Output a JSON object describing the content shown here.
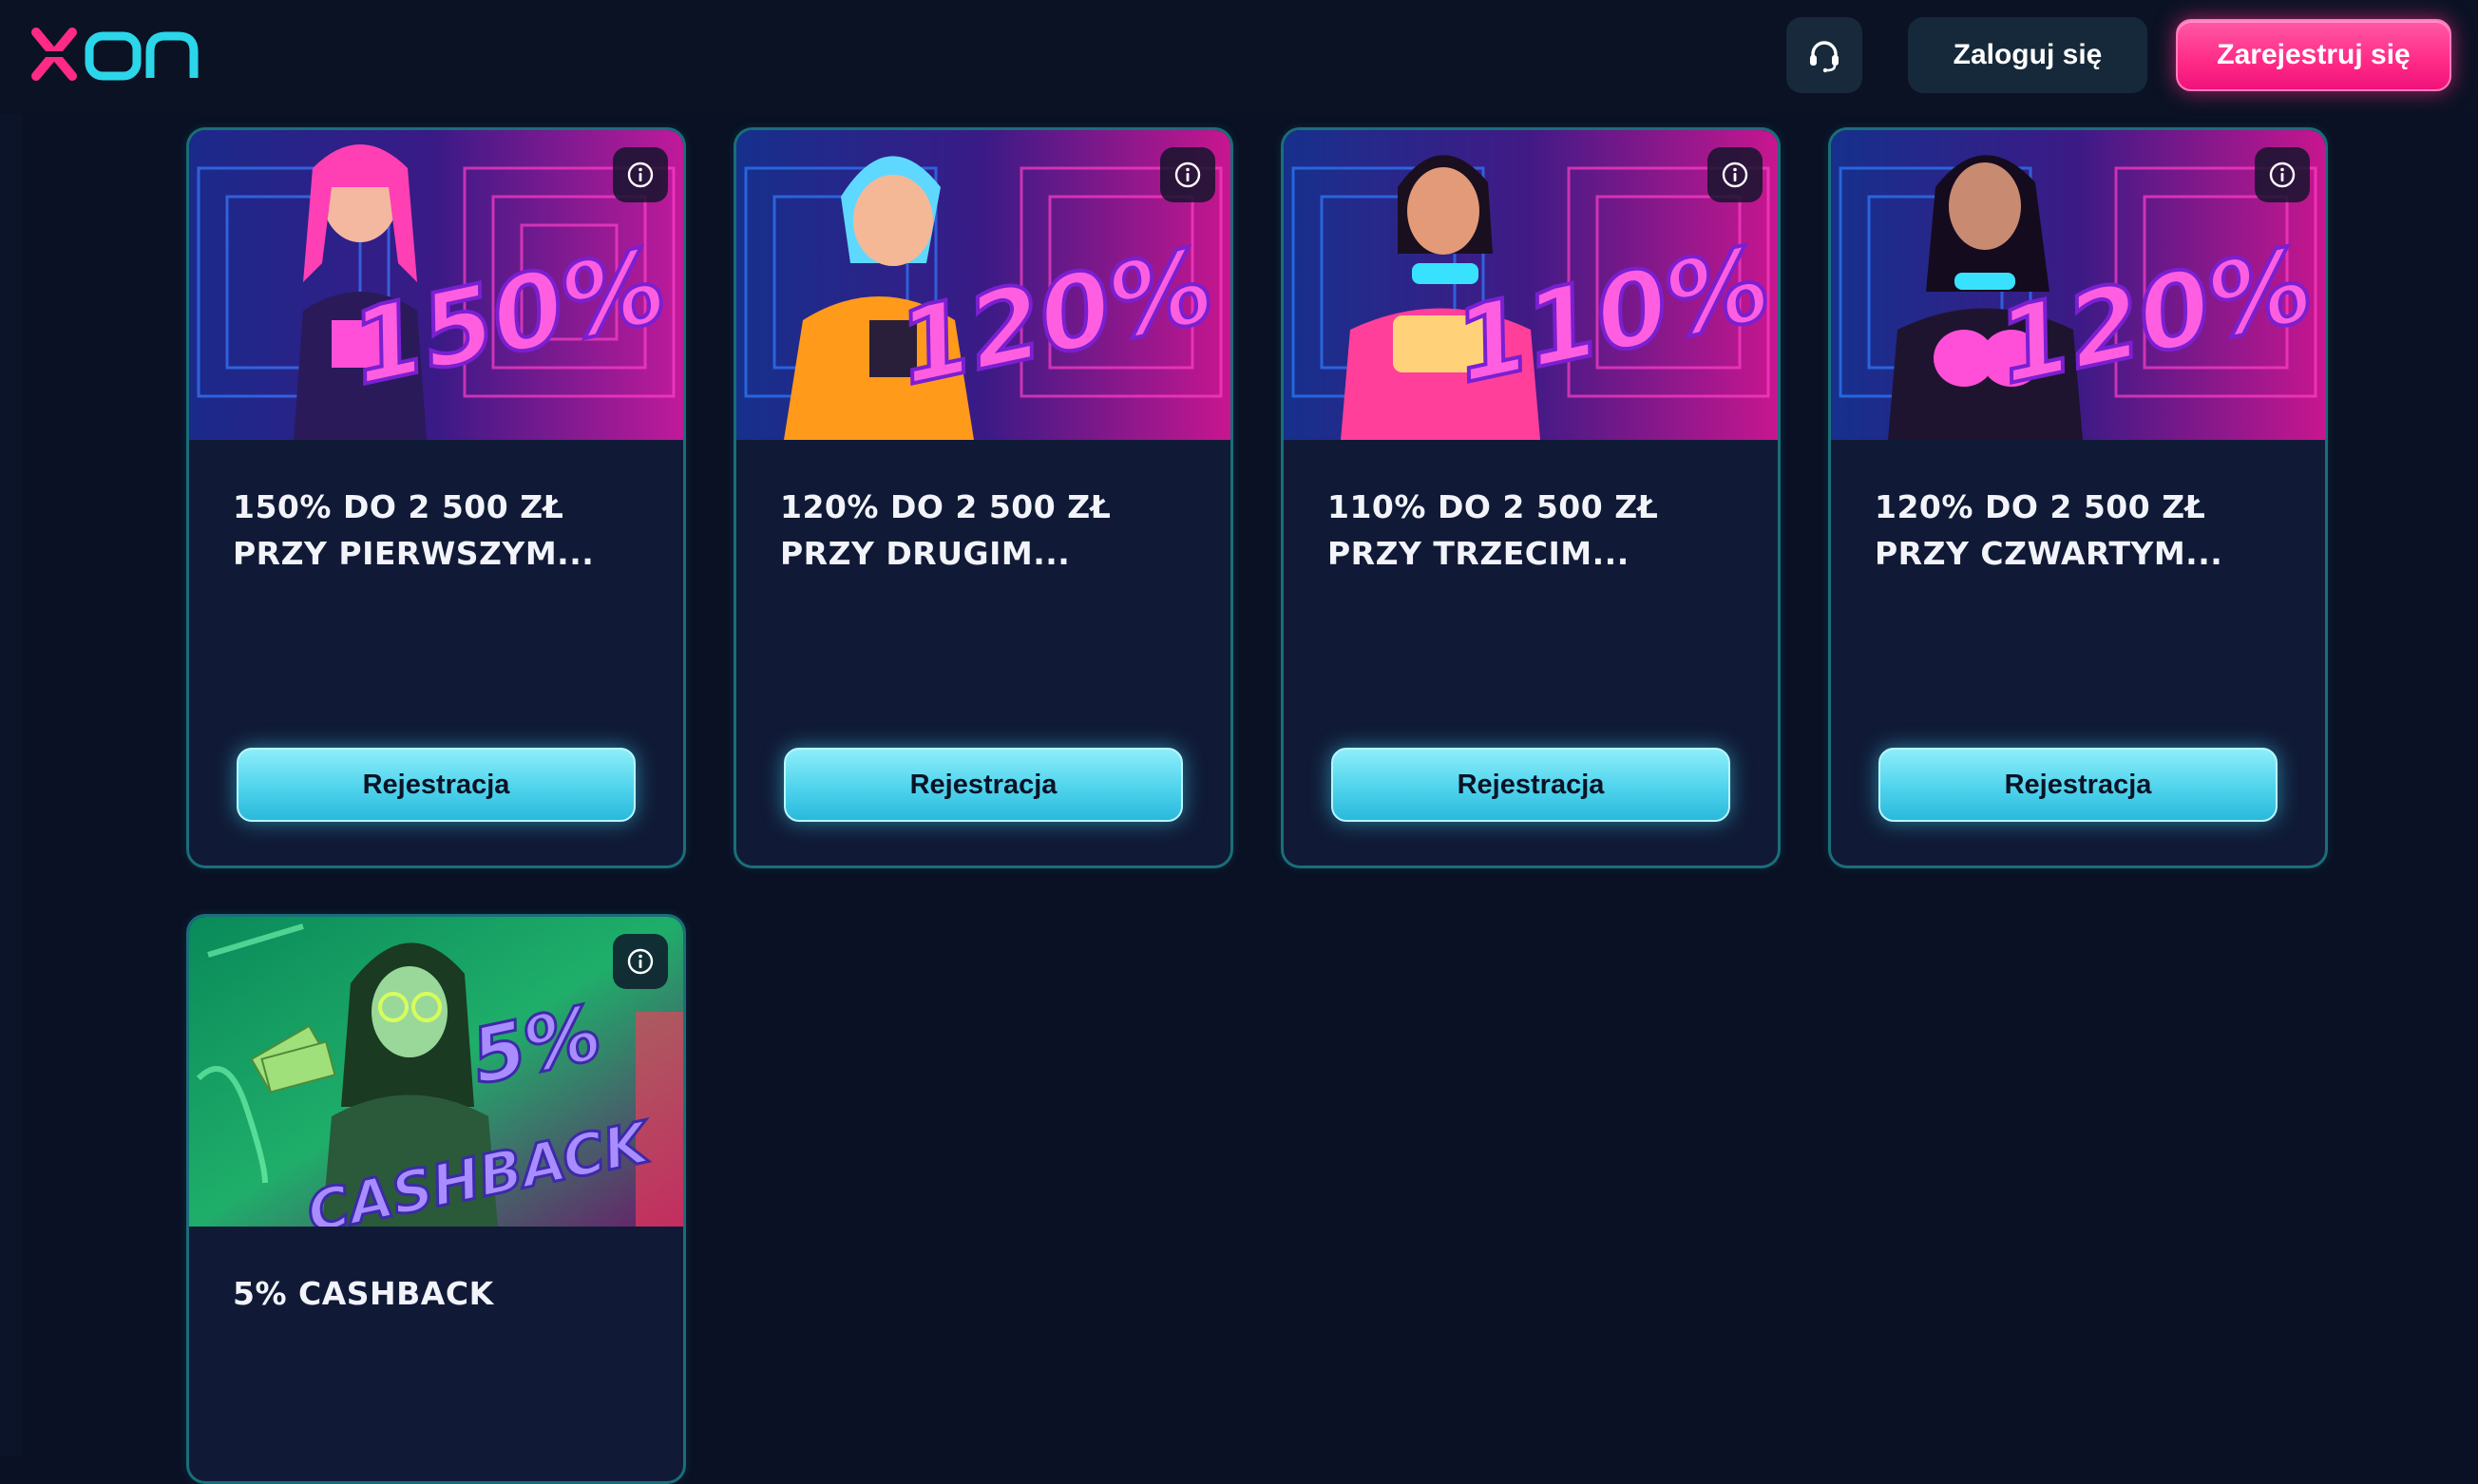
{
  "header": {
    "logo_text": "xon",
    "support_icon": "headset-icon",
    "login_label": "Zaloguj się",
    "register_label": "Zarejestruj się",
    "colors": {
      "brand_pink": "#ff2a86",
      "brand_cyan": "#2bd6ea"
    }
  },
  "cards": [
    {
      "image_badge": "150%",
      "title_line1": "150% DO 2 500 ZŁ",
      "title_line2": "PRZY PIERWSZYM...",
      "cta_label": "Rejestracja",
      "info_icon": "info-icon"
    },
    {
      "image_badge": "120%",
      "title_line1": "120% DO 2 500 ZŁ",
      "title_line2": "PRZY DRUGIM...",
      "cta_label": "Rejestracja",
      "info_icon": "info-icon"
    },
    {
      "image_badge": "110%",
      "title_line1": "110% DO 2 500 ZŁ",
      "title_line2": "PRZY TRZECIM...",
      "cta_label": "Rejestracja",
      "info_icon": "info-icon"
    },
    {
      "image_badge": "120%",
      "title_line1": "120% DO 2 500 ZŁ",
      "title_line2": "PRZY CZWARTYM...",
      "cta_label": "Rejestracja",
      "info_icon": "info-icon"
    },
    {
      "image_badge_line1": "5%",
      "image_badge_line2": "CASHBACK",
      "title_line1": "5% CASHBACK",
      "info_icon": "info-icon"
    }
  ]
}
